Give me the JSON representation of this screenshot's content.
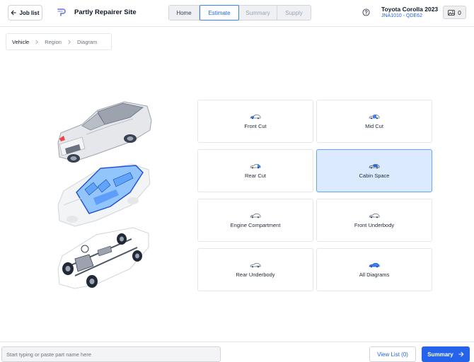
{
  "header": {
    "job_list_label": "Job list",
    "site_name": "Partly Repairer Site",
    "tabs": [
      {
        "label": "Home"
      },
      {
        "label": "Estimate"
      },
      {
        "label": "Summary"
      },
      {
        "label": "Supply"
      }
    ],
    "active_tab": "Estimate",
    "vehicle_name": "Toyota Corolla 2023",
    "vehicle_code": "JNA1010 - QDE62",
    "images_count": "0"
  },
  "breadcrumb": {
    "items": [
      {
        "label": "Vehicle"
      },
      {
        "label": "Region"
      },
      {
        "label": "Diagram"
      }
    ]
  },
  "regions": [
    {
      "label": "Front Cut"
    },
    {
      "label": "Mid Cut"
    },
    {
      "label": "Rear Cut"
    },
    {
      "label": "Cabin Space",
      "selected": true
    },
    {
      "label": "Engine Compartment"
    },
    {
      "label": "Front Underbody"
    },
    {
      "label": "Rear Underbody"
    },
    {
      "label": "All Diagrams"
    }
  ],
  "footer": {
    "search_placeholder": "Start typing or paste part name here",
    "view_list_label": "View List (0)",
    "summary_label": "Summary"
  },
  "colors": {
    "accent": "#2563eb",
    "selected_bg": "#dbeafe",
    "border": "#e5e7eb"
  }
}
